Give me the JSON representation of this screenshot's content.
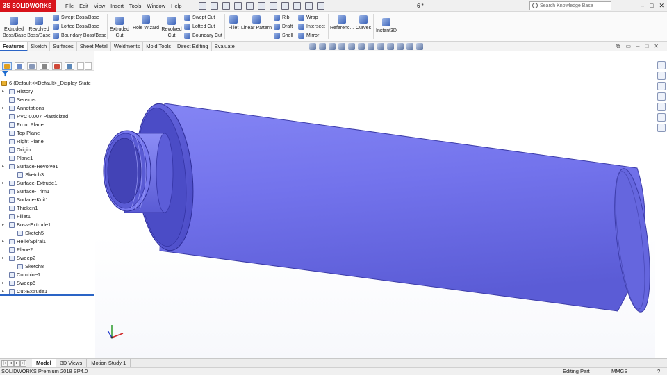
{
  "app": {
    "brand": "SOLIDWORKS",
    "brand_mark": "3S",
    "doc_title": "6 *"
  },
  "menu": [
    "File",
    "Edit",
    "View",
    "Insert",
    "Tools",
    "Window",
    "Help"
  ],
  "search": {
    "placeholder": "Search Knowledge Base"
  },
  "window_controls": [
    "–",
    "□",
    "✕"
  ],
  "ribbon": {
    "extruded_boss": "Extruded Boss/Base",
    "revolved_boss": "Revolved Boss/Base",
    "swept_boss": "Swept Boss/Base",
    "lofted_boss": "Lofted Boss/Base",
    "boundary_boss": "Boundary Boss/Base",
    "extruded_cut": "Extruded Cut",
    "hole_wizard": "Hole Wizard",
    "revolved_cut": "Revolved Cut",
    "swept_cut": "Swept Cut",
    "lofted_cut": "Lofted Cut",
    "boundary_cut": "Boundary Cut",
    "fillet": "Fillet",
    "linear_pattern": "Linear Pattern",
    "rib": "Rib",
    "draft": "Draft",
    "shell": "Shell",
    "wrap": "Wrap",
    "intersect": "Intersect",
    "mirror": "Mirror",
    "reference": "Referenc...",
    "curves": "Curves",
    "instant3d": "Instant3D"
  },
  "tabs": [
    "Features",
    "Sketch",
    "Surfaces",
    "Sheet Metal",
    "Weldments",
    "Mold Tools",
    "Direct Editing",
    "Evaluate"
  ],
  "tree": {
    "root": "6  (Default<<Default>_Display State",
    "items": [
      {
        "label": "History",
        "level": 0,
        "expand": true
      },
      {
        "label": "Sensors",
        "level": 0,
        "expand": false
      },
      {
        "label": "Annotations",
        "level": 0,
        "expand": true
      },
      {
        "label": "PVC 0.007 Plasticized",
        "level": 0,
        "expand": false
      },
      {
        "label": "Front Plane",
        "level": 0,
        "expand": false
      },
      {
        "label": "Top Plane",
        "level": 0,
        "expand": false
      },
      {
        "label": "Right Plane",
        "level": 0,
        "expand": false
      },
      {
        "label": "Origin",
        "level": 0,
        "expand": false
      },
      {
        "label": "Plane1",
        "level": 0,
        "expand": false
      },
      {
        "label": "Surface-Revolve1",
        "level": 0,
        "expand": true
      },
      {
        "label": "Sketch3",
        "level": 1,
        "expand": false
      },
      {
        "label": "Surface-Extrude1",
        "level": 0,
        "expand": true
      },
      {
        "label": "Surface-Trim1",
        "level": 0,
        "expand": false
      },
      {
        "label": "Surface-Knit1",
        "level": 0,
        "expand": false
      },
      {
        "label": "Thicken1",
        "level": 0,
        "expand": false
      },
      {
        "label": "Fillet1",
        "level": 0,
        "expand": false
      },
      {
        "label": "Boss-Extrude1",
        "level": 0,
        "expand": true
      },
      {
        "label": "Sketch5",
        "level": 1,
        "expand": false
      },
      {
        "label": "Helix/Spiral1",
        "level": 0,
        "expand": true
      },
      {
        "label": "Plane2",
        "level": 0,
        "expand": false
      },
      {
        "label": "Sweep2",
        "level": 0,
        "expand": true
      },
      {
        "label": "Sketch8",
        "level": 1,
        "expand": false
      },
      {
        "label": "Combine1",
        "level": 0,
        "expand": false
      },
      {
        "label": "Sweep6",
        "level": 0,
        "expand": true
      },
      {
        "label": "Cut-Extrude1",
        "level": 0,
        "expand": true
      }
    ]
  },
  "bottom_tabs": [
    "Model",
    "3D Views",
    "Motion Study 1"
  ],
  "status": {
    "product": "SOLIDWORKS Premium 2018 SP4.0",
    "mode": "Editing Part",
    "units": "MMGS"
  },
  "colors": {
    "model_body": "#6b6ee8",
    "brand_red": "#d8141c",
    "accent": "#2a64c6"
  }
}
